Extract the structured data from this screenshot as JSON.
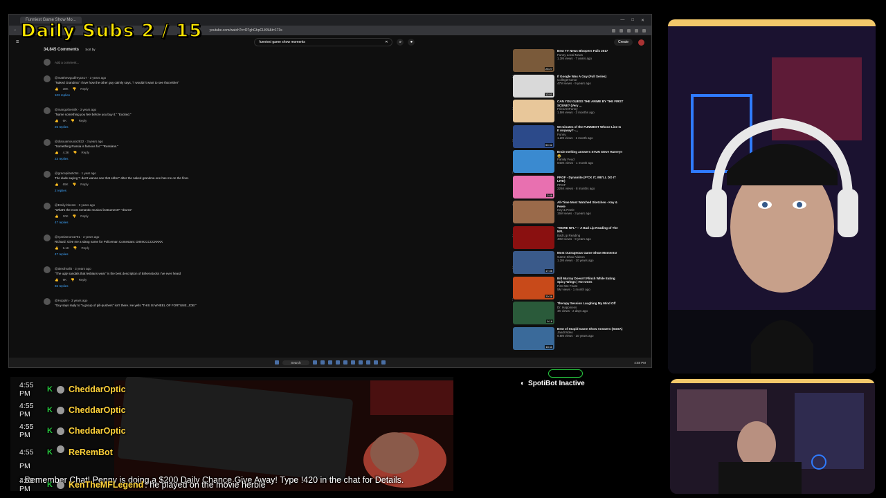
{
  "browser": {
    "tab_title": "Funniest Game Show Mo...",
    "url": "youtube.com/watch?v=R7ghGhpCLKM&t=173s",
    "search": {
      "query": "funniest game show moments"
    },
    "create_label": "Create"
  },
  "comments": {
    "count": "34,845 Comments",
    "sort_label": "Sort by",
    "add_placeholder": "Add a comment...",
    "items": [
      {
        "user": "@matthewgodfrey1617 · 3 years ago",
        "text": "\"Naked Grandma\"  I love how the other guy calmly says, \"I wouldn't want to see that either\"",
        "likes": "38K",
        "reply": "Reply",
        "replies": "103 replies"
      },
      {
        "user": "@mangothemilk · 3 years ago",
        "text": "\"Name something you feel before you buy it.\"  \"Excited.\"",
        "likes": "6K",
        "reply": "Reply",
        "replies": "25 replies"
      },
      {
        "user": "@diaouamouxix2822 · 3 years ago",
        "text": "\"Something Russia is famous for.\"  \"Russians.\"",
        "likes": "4.3K",
        "reply": "Reply",
        "replies": "23 replies"
      },
      {
        "user": "@gracepilastic54 · 1 year ago",
        "text": "The dude saying \"I don't wanna see that either\" after the naked grandma one has me on the floor.",
        "likes": "65K",
        "reply": "Reply",
        "replies": "2 replies"
      },
      {
        "user": "@Emily-bb4sm · 3 years ago",
        "text": "\"What's the most romantic musical instrument?\"  \"drums\"",
        "likes": "10K",
        "reply": "Reply",
        "replies": "47 replies"
      },
      {
        "user": "@ryanlamont1791 · 3 years ago",
        "text": "Richard: Give me a slang name for Policeman  Contestant: DIIIIIICCCCCKKKK",
        "likes": "6.1K",
        "reply": "Reply",
        "replies": "47 replies"
      },
      {
        "user": "@alexthrall4 · 3 years ago",
        "text": "\"The ugly sandals that lesbians wear\" is the best description of Birkenstocks I've ever heard",
        "likes": "9K",
        "reply": "Reply",
        "replies": "36 replies"
      },
      {
        "user": "@Hopplin · 3 years ago",
        "text": "\"Guy says reply to \"a group of pill-pushers\" isn't there. He yells \"THIS IS WHEEL OF FORTUNE, JOE!\"",
        "likes": "",
        "reply": "",
        "replies": ""
      }
    ]
  },
  "recommendations": [
    {
      "title": "Best TV News Bloopers Fails 2017",
      "channel": "Funny Local News",
      "meta": "1.3M views · 7 years ago",
      "duration": "25:27",
      "color": "#7a5a3a"
    },
    {
      "title": "If Google Was A Guy (Full Series)",
      "channel": "CollegeHumor",
      "meta": "47M views · 9 years ago",
      "duration": "12:01",
      "color": "#d9d9d9"
    },
    {
      "title": "CAN YOU GUESS THE ANIME BY THE FIRST SCENE? (Very ...",
      "channel": "FriesAreFunny",
      "meta": "1.5M views · 3 months ago",
      "duration": "",
      "color": "#e8c79a"
    },
    {
      "title": "50 minutes of the FUNNIEST Whose Line Is It Anyway? -...",
      "channel": "Funny",
      "meta": "1.2M views · 1 month ago",
      "duration": "50:32",
      "color": "#2c4a8a"
    },
    {
      "title": "Brain-melting answers STUN Steve Harvey!! 😂",
      "channel": "Family Feud",
      "meta": "840K views · 1 month ago",
      "duration": "",
      "color": "#3a8ad0"
    },
    {
      "title": "PROF - Dynamite (F*CK IT, WE'LL DO IT LIVE)",
      "channel": "PROF",
      "meta": "226K views · 8 months ago",
      "duration": "2:46",
      "color": "#e870b0"
    },
    {
      "title": "All-Time Most Watched Sketches - Key & Peele",
      "channel": "Key & Peele",
      "meta": "15M views · 3 years ago",
      "duration": "",
      "color": "#9a6a4a"
    },
    {
      "title": "\"MORE NFL\" -- A Bad Lip Reading of The NFL",
      "channel": "Bad Lip Reading",
      "meta": "40M views · 9 years ago",
      "duration": "",
      "color": "#8a1010"
    },
    {
      "title": "Most Outrageous Game Show Moments!",
      "channel": "Game Show Videos",
      "meta": "1.2M views · 10 years ago",
      "duration": "17:36",
      "color": "#3a5a8a"
    },
    {
      "title": "Bill Murray Doesn't Flinch While Eating Spicy Wings | Hot Ones",
      "channel": "First We Feast",
      "meta": "5M views · 1 month ago",
      "duration": "20:38",
      "color": "#c84a1a"
    },
    {
      "title": "Therapy Session Laughing My Mind Off",
      "channel": "Dr. Happiness",
      "meta": "4K views · 2 days ago",
      "duration": "9:18",
      "color": "#2a5a3a"
    },
    {
      "title": "Best of Stupid Game Show Answers (SGSA)",
      "channel": "JandrVideo",
      "meta": "9.8M views · 10 years ago",
      "duration": "18:11",
      "color": "#3a6a9a"
    }
  ],
  "taskbar": {
    "search_label": "Search",
    "clock": "4:58 PM"
  },
  "overlay": {
    "title": "Daily Subs  2 / 15"
  },
  "chat": [
    {
      "time": "4:55 PM",
      "user": "CheddarOptic",
      "text": "",
      "user_color": "#ffd23a"
    },
    {
      "time": "4:55 PM",
      "user": "CheddarOptic",
      "text": "",
      "user_color": "#ffd23a"
    },
    {
      "time": "4:55 PM",
      "user": "CheddarOptic",
      "text": "",
      "user_color": "#ffd23a"
    },
    {
      "time": "4:55 PM",
      "user": "ReRemBot",
      "text": ": Remember Chat! Penny is doing a $200 Daily Chance Give Away! Type !420 in the chat for Details.",
      "user_color": "#ffd23a"
    },
    {
      "time": "4:58 PM",
      "user": "KenTheMFLegend",
      "text": ": he played on the movie herbie",
      "user_color": "#ffd23a"
    }
  ],
  "spotibot": {
    "label": "SpotiBot Inactive"
  }
}
